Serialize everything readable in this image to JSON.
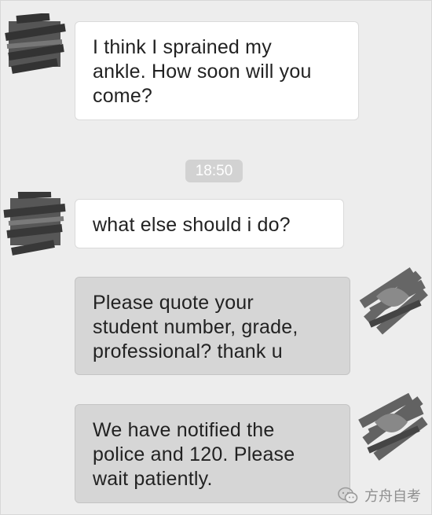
{
  "conversation": {
    "time_stamp": "18:50",
    "messages": [
      {
        "sender": "student",
        "text": "I think I sprained my\nankle. How soon will you\n come?"
      },
      {
        "sender": "student",
        "text": "what else should i do?"
      },
      {
        "sender": "agent",
        "text": "Please quote your\nstudent number, grade,\nprofessional?  thank u"
      },
      {
        "sender": "agent",
        "text": "We have notified the\npolice and 120. Please\nwait patiently."
      }
    ]
  },
  "watermark": {
    "text": "方舟自考",
    "icon": "wechat-icon"
  },
  "colors": {
    "background": "#ededed",
    "incoming_bubble": "#ffffff",
    "outgoing_bubble": "#d6d6d6",
    "time_pill": "#d2d2d2"
  }
}
